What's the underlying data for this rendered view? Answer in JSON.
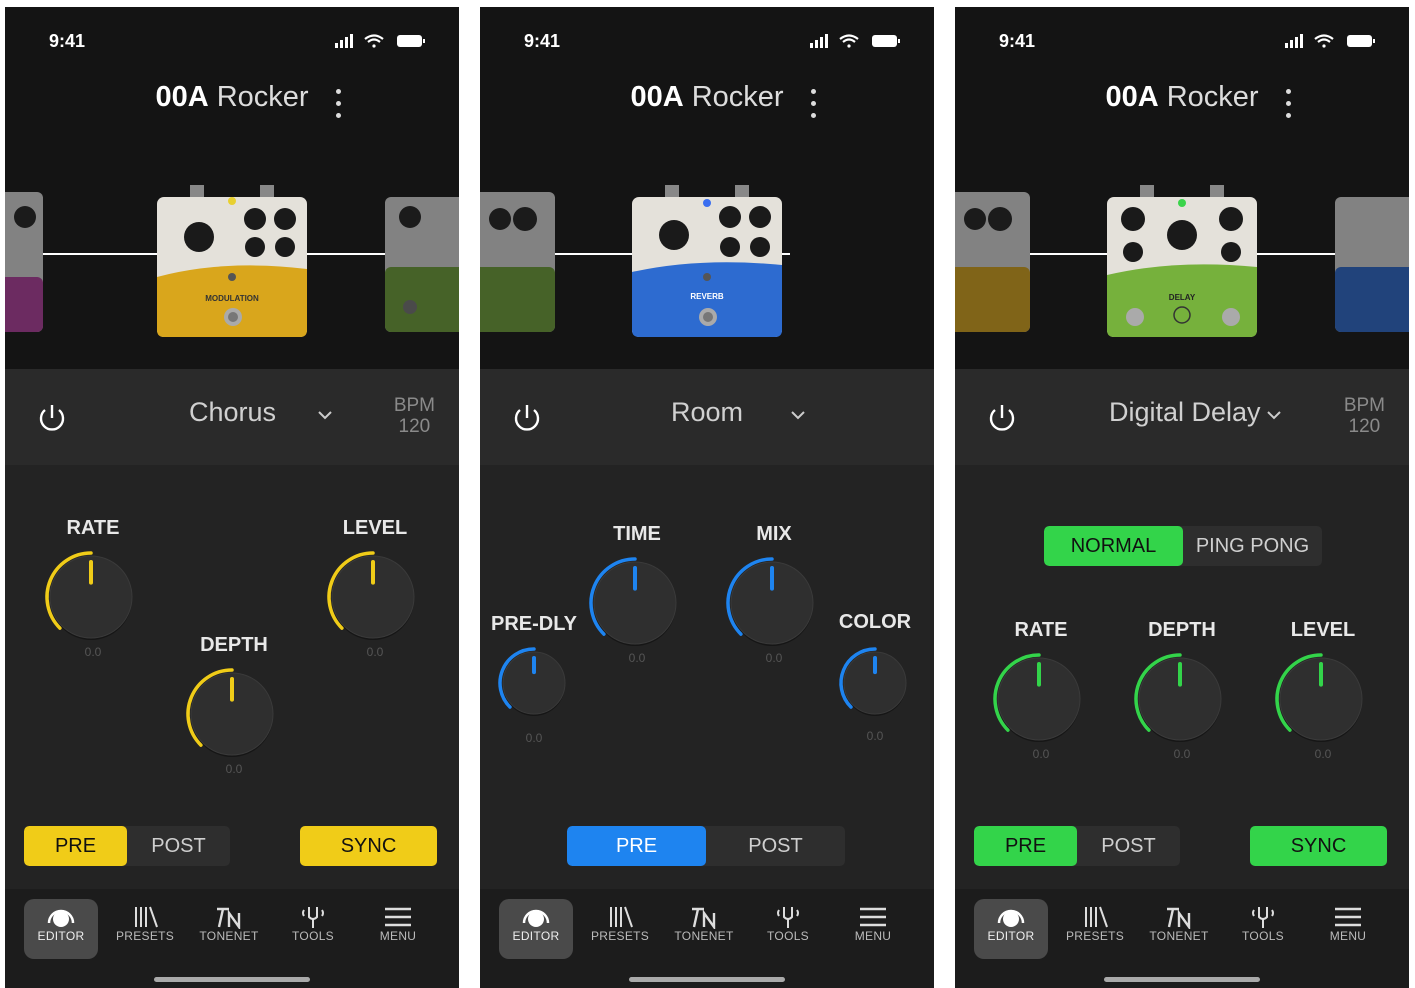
{
  "status": {
    "time": "9:41"
  },
  "preset": {
    "id": "00A",
    "name": "Rocker"
  },
  "colors": {
    "modulation": "#f0cc18",
    "reverb": "#1e84f0",
    "delay": "#33d44a"
  },
  "screens": [
    {
      "effect": "Chorus",
      "bpm_label": "BPM",
      "bpm_value": "120",
      "pedal_label": "MODULATION",
      "knobs": [
        {
          "label": "RATE",
          "value": "0.0"
        },
        {
          "label": "LEVEL",
          "value": "0.0"
        },
        {
          "label": "DEPTH",
          "value": "0.0"
        }
      ],
      "toggle": {
        "options": [
          "PRE",
          "POST"
        ],
        "selected": "PRE"
      },
      "sync": "SYNC"
    },
    {
      "effect": "Room",
      "pedal_label": "REVERB",
      "knobs": [
        {
          "label": "TIME",
          "value": "0.0"
        },
        {
          "label": "MIX",
          "value": "0.0"
        },
        {
          "label": "PRE-DLY",
          "value": "0.0"
        },
        {
          "label": "COLOR",
          "value": "0.0"
        }
      ],
      "toggle": {
        "options": [
          "PRE",
          "POST"
        ],
        "selected": "PRE"
      }
    },
    {
      "effect": "Digital Delay",
      "bpm_label": "BPM",
      "bpm_value": "120",
      "pedal_label": "DELAY",
      "mode": {
        "options": [
          "NORMAL",
          "PING PONG"
        ],
        "selected": "NORMAL"
      },
      "knobs": [
        {
          "label": "RATE",
          "value": "0.0"
        },
        {
          "label": "DEPTH",
          "value": "0.0"
        },
        {
          "label": "LEVEL",
          "value": "0.0"
        }
      ],
      "toggle": {
        "options": [
          "PRE",
          "POST"
        ],
        "selected": "PRE"
      },
      "sync": "SYNC"
    }
  ],
  "tabs": [
    {
      "label": "EDITOR",
      "icon": "editor-knob-icon",
      "active": true
    },
    {
      "label": "PRESETS",
      "icon": "presets-library-icon"
    },
    {
      "label": "TONENET",
      "icon": "tonenet-icon"
    },
    {
      "label": "TOOLS",
      "icon": "tuning-fork-icon"
    },
    {
      "label": "MENU",
      "icon": "hamburger-menu-icon"
    }
  ]
}
